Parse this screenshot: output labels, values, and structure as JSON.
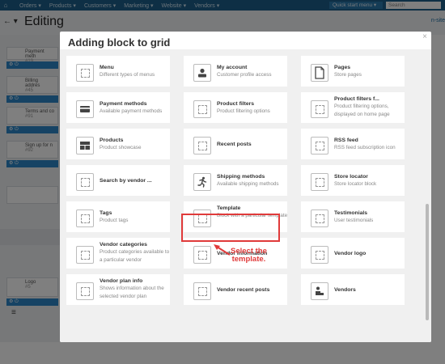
{
  "background": {
    "nav": [
      "Orders ▾",
      "Products ▾",
      "Customers ▾",
      "Marketing ▾",
      "Website ▾",
      "Vendors ▾"
    ],
    "quick_menu": "Quick start menu ▾",
    "search_placeholder": "Search",
    "page_title": "Editing",
    "right_tab": "n-site",
    "grid_blocks": [
      {
        "name": "Payment meth",
        "id": "#19"
      },
      {
        "name": "Billing addres",
        "id": "#45"
      },
      {
        "name": "Terms and co",
        "id": "#91"
      },
      {
        "name": "Sign up for n",
        "id": "#92"
      }
    ],
    "logo_block": {
      "name": "Logo",
      "id": "#5"
    }
  },
  "modal": {
    "title": "Adding block to grid",
    "close_symbol": "×",
    "blocks": [
      {
        "name": "Menu",
        "description": "Different types of menus",
        "icon": "dashed-box-icon"
      },
      {
        "name": "My account",
        "description": "Customer profile access",
        "icon": "user-icon"
      },
      {
        "name": "Pages",
        "description": "Store pages",
        "icon": "page-icon"
      },
      {
        "name": "Payment methods",
        "description": "Available payment methods",
        "icon": "card-icon"
      },
      {
        "name": "Product filters",
        "description": "Product filtering options",
        "icon": "dashed-box-icon"
      },
      {
        "name": "Product filters f...",
        "description": "Product filtering options, displayed on home page",
        "icon": "dashed-box-icon"
      },
      {
        "name": "Products",
        "description": "Product showcase",
        "icon": "showcase-icon"
      },
      {
        "name": "Recent posts",
        "description": "",
        "icon": "dashed-box-icon"
      },
      {
        "name": "RSS feed",
        "description": "RSS feed subscription icon",
        "icon": "dashed-box-icon"
      },
      {
        "name": "Search by vendor ...",
        "description": "",
        "icon": "dashed-box-icon"
      },
      {
        "name": "Shipping methods",
        "description": "Available shipping methods",
        "icon": "runner-icon"
      },
      {
        "name": "Store locator",
        "description": "Store locator block",
        "icon": "dashed-box-icon"
      },
      {
        "name": "Tags",
        "description": "Product tags",
        "icon": "dashed-box-icon"
      },
      {
        "name": "Template",
        "description": "Block with a particular template",
        "icon": "dashed-box-icon"
      },
      {
        "name": "Testimonials",
        "description": "User testimonials",
        "icon": "dashed-box-icon"
      },
      {
        "name": "Vendor categories",
        "description": "Product categories available to a particular vendor",
        "icon": "dashed-box-icon"
      },
      {
        "name": "Vendor information",
        "description": "",
        "icon": "dashed-box-icon"
      },
      {
        "name": "Vendor logo",
        "description": "",
        "icon": "dashed-box-icon"
      },
      {
        "name": "Vendor plan info",
        "description": "Shows information about the selected vendor plan",
        "icon": "dashed-box-icon"
      },
      {
        "name": "Vendor recent posts",
        "description": "",
        "icon": "dashed-box-icon"
      },
      {
        "name": "Vendors",
        "description": "",
        "icon": "vendors-icon"
      }
    ]
  },
  "annotation": {
    "text": "Select the\ntemplate.",
    "color": "#e03a3a"
  }
}
